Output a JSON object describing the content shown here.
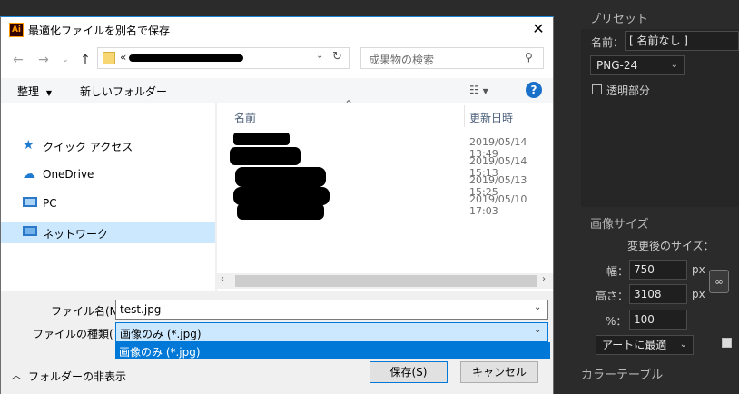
{
  "background_panel": {
    "preset_title": "プリセット",
    "name_label": "名前：",
    "name_value": "[ 名前なし ]",
    "format_value": "PNG-24",
    "transparency_label": "透明部分",
    "image_size_title": "画像サイズ",
    "new_size_label": "変更後のサイズ：",
    "width_label": "幅：",
    "width_value": "750",
    "height_label": "高さ：",
    "height_value": "3108",
    "percent_label": "%：",
    "percent_value": "100",
    "unit": "px",
    "quality_value": "アートに最適",
    "color_table_title": "カラーテーブル"
  },
  "dialog": {
    "title": "最適化ファイルを別名で保存",
    "app_icon_text": "Ai",
    "close_icon": "✕",
    "address": {
      "path_prefix": "«",
      "search_placeholder": "成果物の検索"
    },
    "toolbar": {
      "organize_label": "整理",
      "new_folder_label": "新しいフォルダー",
      "help_icon": "?"
    },
    "nav": [
      {
        "label": "クイック アクセス",
        "icon": "star-icon"
      },
      {
        "label": "OneDrive",
        "icon": "cloud-icon"
      },
      {
        "label": "PC",
        "icon": "computer-icon"
      },
      {
        "label": "ネットワーク",
        "icon": "network-icon"
      }
    ],
    "columns": {
      "name": "名前",
      "modified": "更新日時"
    },
    "files": [
      {
        "modified": "2019/05/14 13:49"
      },
      {
        "modified": "2019/05/14 15:13"
      },
      {
        "modified": "2019/05/13 15:25"
      },
      {
        "modified": "2019/05/10 17:03"
      }
    ],
    "filename_label": "ファイル名(N):",
    "filename_value": "test.jpg",
    "filetype_label": "ファイルの種類(T):",
    "filetype_value": "画像のみ (*.jpg)",
    "filetype_options": [
      "画像のみ (*.jpg)"
    ],
    "hide_folders_label": "フォルダーの非表示",
    "save_label": "保存(S)",
    "cancel_label": "キャンセル"
  }
}
